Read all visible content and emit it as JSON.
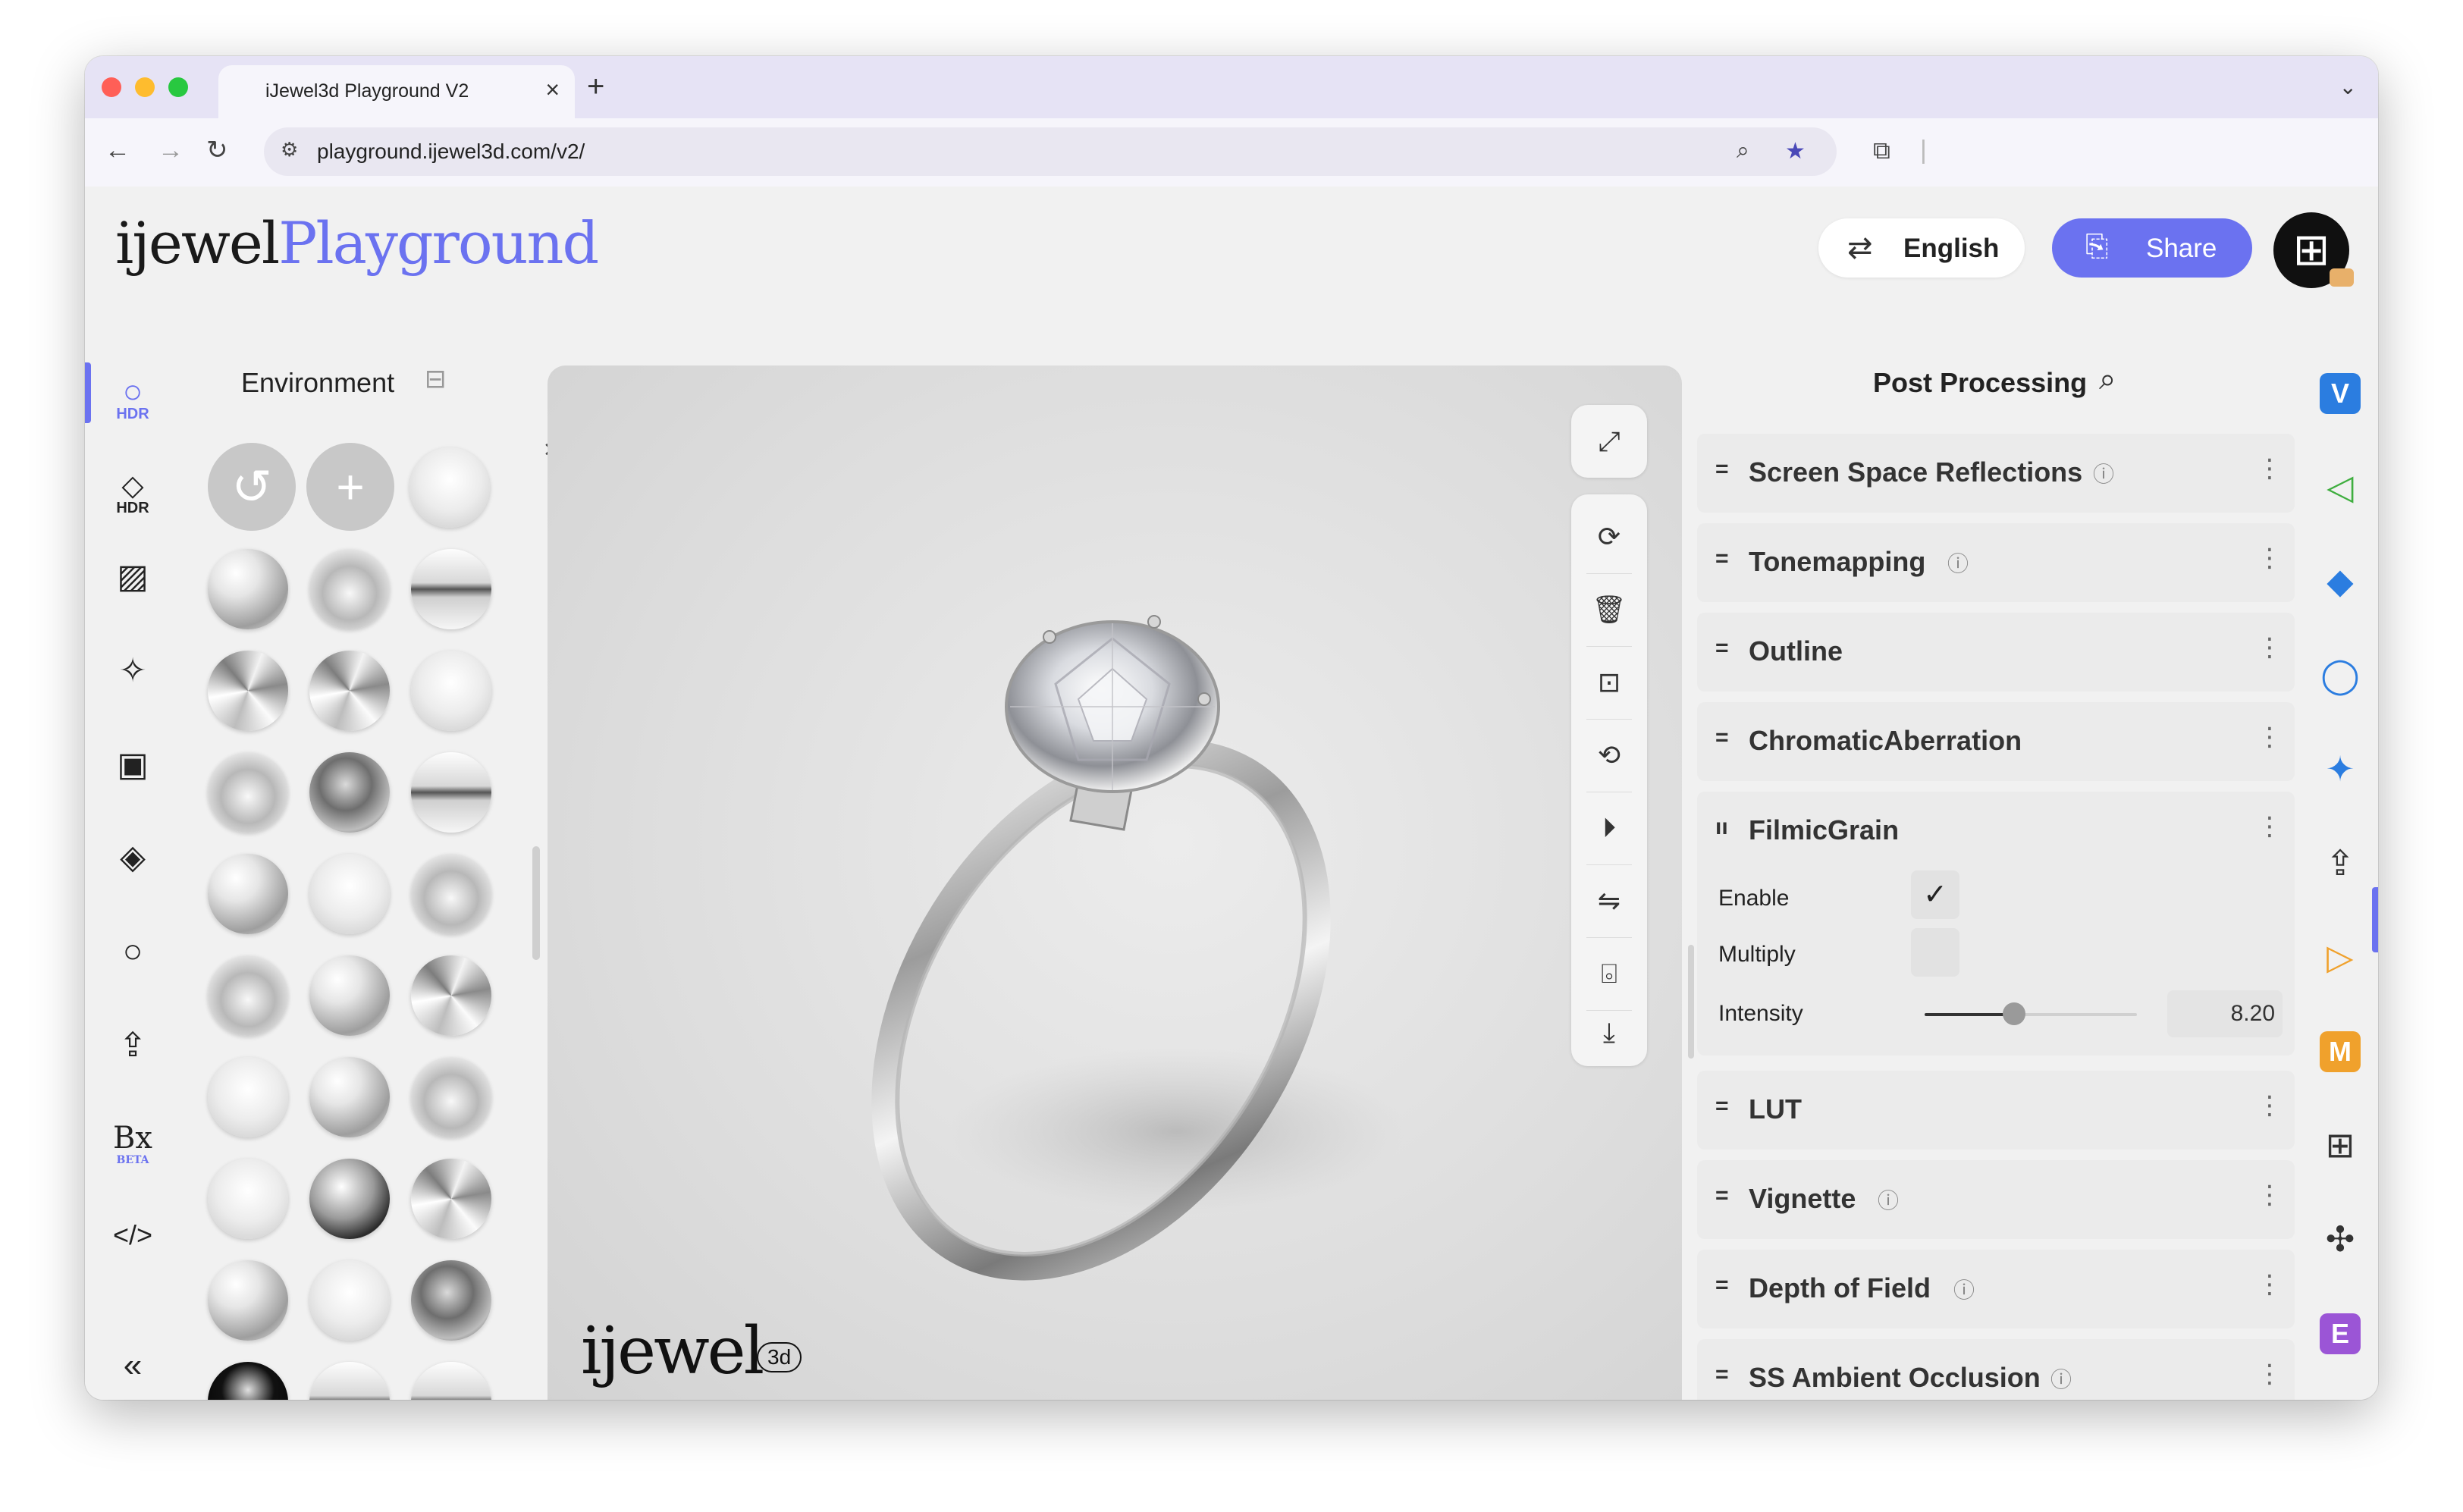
{
  "browser": {
    "tab_title": "iJewel3d Playground V2",
    "new_tab": "+",
    "url": "playground.ijewel3d.com/v2/"
  },
  "header": {
    "logo_part1": "ijewel",
    "logo_part2": "Playground",
    "language_label": "English",
    "share_label": "Share",
    "avatar_glyph": "⊞"
  },
  "left_rail": [
    {
      "name": "hdr-environment",
      "icon": "circle-hdr",
      "sub": "HDR"
    },
    {
      "name": "hdr-diamond",
      "icon": "diamond-hdr",
      "sub": "HDR"
    },
    {
      "name": "background",
      "icon": "stripes"
    },
    {
      "name": "sparkle",
      "icon": "sparkle"
    },
    {
      "name": "image-frame",
      "icon": "image"
    },
    {
      "name": "ground-plane",
      "icon": "plane"
    },
    {
      "name": "ring",
      "icon": "ring"
    },
    {
      "name": "upload",
      "icon": "upload"
    },
    {
      "name": "bx-beta",
      "icon": "bx",
      "sub": "BETA"
    },
    {
      "name": "code",
      "icon": "code"
    },
    {
      "name": "collapse",
      "icon": "double-chevron-left"
    }
  ],
  "environment": {
    "title": "Environment",
    "title_icon": "book-icon"
  },
  "viewport": {
    "watermark": "ijewel",
    "watermark_tag": "3d",
    "tools": [
      "expand-icon",
      "refresh-icon",
      "trash-icon",
      "focus-icon",
      "rotate-icon",
      "play-icon",
      "flip-icon",
      "camera-icon",
      "download-icon"
    ]
  },
  "post_processing": {
    "title": "Post Processing",
    "items": [
      {
        "label": "Screen Space Reflections",
        "info": true
      },
      {
        "label": "Tonemapping",
        "info": true
      },
      {
        "label": "Outline",
        "info": false
      },
      {
        "label": "ChromaticAberration",
        "info": false
      },
      {
        "label": "FilmicGrain",
        "info": false
      },
      {
        "label": "LUT",
        "info": false
      },
      {
        "label": "Vignette",
        "info": true
      },
      {
        "label": "Depth of Field",
        "info": true
      },
      {
        "label": "SS Ambient Occlusion",
        "info": true
      }
    ],
    "filmic_grain": {
      "enable_label": "Enable",
      "enable_checked": true,
      "multiply_label": "Multiply",
      "multiply_checked": false,
      "intensity_label": "Intensity",
      "intensity_value": "8.20",
      "intensity_fraction": 0.42
    }
  },
  "right_rail": [
    {
      "name": "v-plugin",
      "glyph": "V",
      "color": "#2b7de0"
    },
    {
      "name": "cursor",
      "glyph": "◁",
      "color": "#3fae3f"
    },
    {
      "name": "shapes",
      "glyph": "◆",
      "color": "#2b7de0"
    },
    {
      "name": "loop",
      "glyph": "◯",
      "color": "#2b7de0"
    },
    {
      "name": "sparkle",
      "glyph": "✦",
      "color": "#2b7de0"
    },
    {
      "name": "upload",
      "glyph": "⇪",
      "color": "#333333"
    },
    {
      "name": "play",
      "glyph": "▷",
      "color": "#f0a12c"
    },
    {
      "name": "m-plugin",
      "glyph": "M",
      "color": "#f0a12c"
    },
    {
      "name": "grid",
      "glyph": "⊞",
      "color": "#333333"
    },
    {
      "name": "puzzle",
      "glyph": "✣",
      "color": "#333333"
    },
    {
      "name": "e-plugin",
      "glyph": "E",
      "color": "#9b55d6"
    }
  ]
}
